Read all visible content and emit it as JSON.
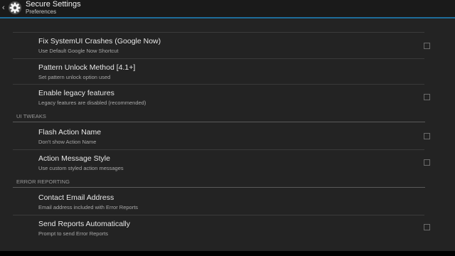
{
  "action_bar": {
    "up_glyph": "‹",
    "app_icon": "gear-icon",
    "title": "Secure Settings",
    "subtitle": "Preferences",
    "accent_color": "#1e6c99"
  },
  "preferences": [
    {
      "title": "Fix SystemUI Crashes (Google Now)",
      "summary": "Use Default Google Now Shortcut",
      "checkbox": true,
      "checked": false
    },
    {
      "title": "Pattern Unlock Method [4.1+]",
      "summary": "Set pattern unlock option used",
      "checkbox": false
    },
    {
      "title": "Enable legacy features",
      "summary": "Legacy features are disabled (recommended)",
      "checkbox": true,
      "checked": false
    }
  ],
  "categories": [
    {
      "label": "UI TWEAKS",
      "items": [
        {
          "title": "Flash Action Name",
          "summary": "Don't show Action Name",
          "checkbox": true,
          "checked": false
        },
        {
          "title": "Action Message Style",
          "summary": "Use custom styled action messages",
          "checkbox": true,
          "checked": false
        }
      ]
    },
    {
      "label": "ERROR REPORTING",
      "items": [
        {
          "title": "Contact Email Address",
          "summary": "Email address included with Error Reports",
          "checkbox": false
        },
        {
          "title": "Send Reports Automatically",
          "summary": "Prompt to send Error Reports",
          "checkbox": true,
          "checked": false
        }
      ]
    }
  ]
}
